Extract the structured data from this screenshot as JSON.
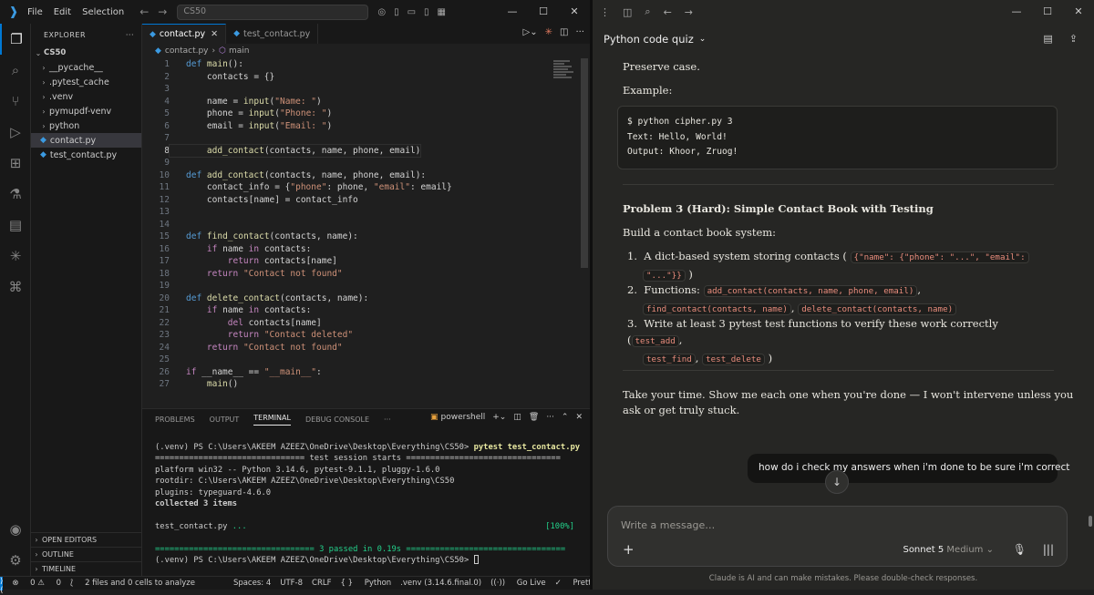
{
  "vscode": {
    "menu": [
      "File",
      "Edit",
      "Selection"
    ],
    "search": "CS50",
    "explorer": {
      "title": "EXPLORER",
      "root": "CS50",
      "items": [
        {
          "label": "__pycache__",
          "type": "folder"
        },
        {
          "label": ".pytest_cache",
          "type": "folder"
        },
        {
          "label": ".venv",
          "type": "folder"
        },
        {
          "label": "pymupdf-venv",
          "type": "folder"
        },
        {
          "label": "python",
          "type": "folder"
        },
        {
          "label": "contact.py",
          "type": "file",
          "selected": true
        },
        {
          "label": "test_contact.py",
          "type": "file"
        }
      ],
      "footer": [
        "OPEN EDITORS",
        "OUTLINE",
        "TIMELINE"
      ]
    },
    "tabs": [
      {
        "label": "contact.py",
        "active": true
      },
      {
        "label": "test_contact.py",
        "active": false
      }
    ],
    "breadcrumb": {
      "file": "contact.py",
      "symbol": "main"
    },
    "code": [
      "def main():",
      "    contacts = {}",
      "",
      "    name = input(\"Name: \")",
      "    phone = input(\"Phone: \")",
      "    email = input(\"Email: \")",
      "",
      "    add_contact(contacts, name, phone, email)",
      "",
      "def add_contact(contacts, name, phone, email):",
      "    contact_info = {\"phone\": phone, \"email\": email}",
      "    contacts[name] = contact_info",
      "",
      "",
      "def find_contact(contacts, name):",
      "    if name in contacts:",
      "        return contacts[name]",
      "    return \"Contact not found\"",
      "",
      "def delete_contact(contacts, name):",
      "    if name in contacts:",
      "        del contacts[name]",
      "        return \"Contact deleted\"",
      "    return \"Contact not found\"",
      "",
      "if __name__ == \"__main__\":",
      "    main()"
    ],
    "current_line": 8,
    "panel": {
      "tabs": [
        "PROBLEMS",
        "OUTPUT",
        "TERMINAL",
        "DEBUG CONSOLE",
        "···"
      ],
      "active_tab": "TERMINAL",
      "shell": "powershell",
      "terminal": {
        "prompt": "(.venv) PS C:\\Users\\AKEEM AZEEZ\\OneDrive\\Desktop\\Everything\\CS50> ",
        "command": "pytest test_contact.py",
        "session_line": "=============================== test session starts ================================",
        "lines": [
          "platform win32 -- Python 3.14.6, pytest-9.1.1, pluggy-1.6.0",
          "rootdir: C:\\Users\\AKEEM AZEEZ\\OneDrive\\Desktop\\Everything\\CS50",
          "plugins: typeguard-4.6.0"
        ],
        "collected": "collected 3 items",
        "test_file": "test_contact.py ",
        "dots": "...",
        "pct": "[100%]",
        "passed_line": "================================= 3 passed in 0.19s ================================="
      }
    },
    "status": {
      "errors": "0",
      "warnings": "0",
      "analyze": "2 files and 0 cells to analyze",
      "spaces": "Spaces: 4",
      "encoding": "UTF-8",
      "eol": "CRLF",
      "lang": "Python",
      "env": ".venv (3.14.6.final.0)",
      "golive": "Go Live",
      "prettier": "Prettier"
    }
  },
  "claude": {
    "title": "Python code quiz",
    "top_partial": "Preserve case.",
    "example_label": "Example:",
    "example_code": [
      "$ python cipher.py 3",
      "Text: Hello, World!",
      "Output: Khoor, Zruog!"
    ],
    "problem_title": "Problem 3 (Hard): Simple Contact Book with Testing",
    "problem_intro": "Build a contact book system:",
    "list": {
      "item1_text": "A dict-based system storing contacts (",
      "item1_code_a": "{\"name\": {\"phone\": \"...\", \"email\":",
      "item1_code_b": "\"...\"}}",
      "item1_end": ")",
      "item2_text": "Functions:",
      "item2_code_a": "add_contact(contacts, name, phone, email)",
      "item2_code_b": "find_contact(contacts, name)",
      "item2_code_c": "delete_contact(contacts, name)",
      "item3_text": "Write at least 3 pytest test functions to verify these work correctly (",
      "item3_code_a": "test_add",
      "item3_code_b": "test_find",
      "item3_code_c": "test_delete",
      "item3_end": ")"
    },
    "closing_line1": "Take your time. Show me each one when you're done — I won't intervene unless you",
    "closing_line2": "ask or get truly stuck.",
    "user_message": "how do i check my answers when i'm done to be sure i'm correct",
    "composer_placeholder": "Write a message…",
    "model": "Sonnet 5",
    "effort": "Medium",
    "disclaimer": "Claude is AI and can make mistakes. Please double-check responses."
  }
}
